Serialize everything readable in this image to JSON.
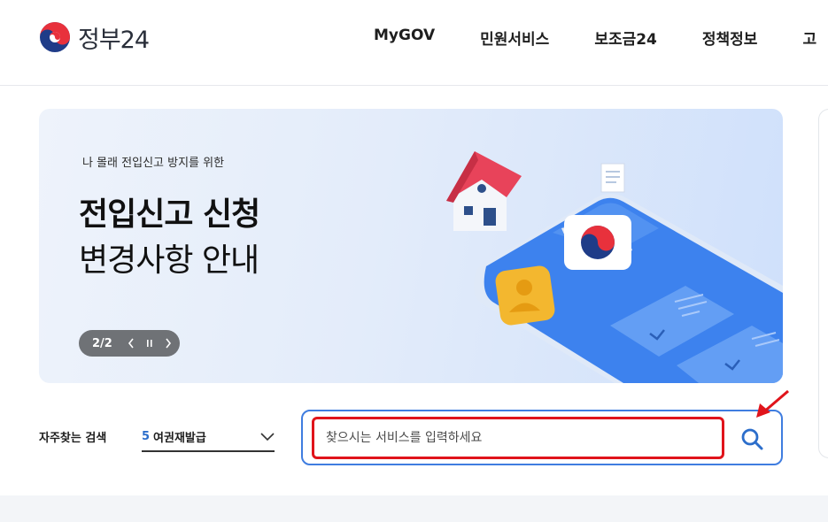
{
  "header": {
    "logo_text": "정부24",
    "nav": [
      "MyGOV",
      "민원서비스",
      "보조금24",
      "정책정보",
      "고"
    ]
  },
  "banner": {
    "subtitle": "나 몰래 전입신고 방지를 위한",
    "title_line1": "전입신고 신청",
    "title_line2": "변경사항 안내",
    "slide_count": "2/2"
  },
  "search": {
    "frequent_label": "자주찾는 검색",
    "frequent_rank": "5",
    "frequent_term": "여권재발급",
    "placeholder": "찾으시는 서비스를 입력하세요",
    "value": ""
  },
  "colors": {
    "accent_blue": "#3f7de0",
    "highlight_red": "#e0141b"
  }
}
